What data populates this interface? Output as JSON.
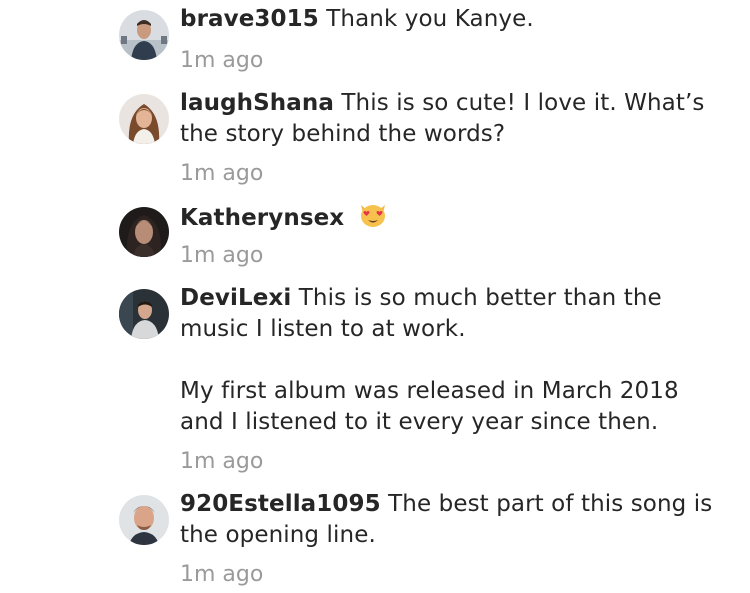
{
  "comments": [
    {
      "username": "brave3015",
      "text": "Thank you Kanye.",
      "time": "1m ago"
    },
    {
      "username": "laughShana",
      "text": "This is so cute! I love it. What’s the story behind the words?",
      "time": "1m ago"
    },
    {
      "username": "Katherynsex",
      "text": "",
      "emoji": "heart-eyes-cat-emoji",
      "time": "1m ago"
    },
    {
      "username": "DeviLexi",
      "text": "This is so much better than the music I listen to at work.\n\nMy first album was released in March 2018 and I listened to it every year since then.",
      "time": "1m ago"
    },
    {
      "username": "920Estella1095",
      "text": "The best part of this song is the opening line.",
      "time": "1m ago"
    }
  ],
  "colors": {
    "text": "#262626",
    "timestamp": "#9a9a9a",
    "background": "#ffffff"
  }
}
